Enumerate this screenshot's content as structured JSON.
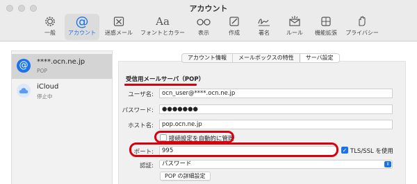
{
  "window": {
    "title": "アカウント"
  },
  "toolbar": {
    "tabs": [
      {
        "label": "一般",
        "icon": "gear-icon"
      },
      {
        "label": "アカウント",
        "icon": "at-sign-icon",
        "active": true
      },
      {
        "label": "迷惑メール",
        "icon": "junk-tray-icon"
      },
      {
        "label": "フォントとカラー",
        "icon": "font-aa-icon"
      },
      {
        "label": "表示",
        "icon": "glasses-icon"
      },
      {
        "label": "作成",
        "icon": "compose-icon"
      },
      {
        "label": "署名",
        "icon": "signature-icon"
      },
      {
        "label": "ルール",
        "icon": "rules-envelope-icon"
      },
      {
        "label": "機能拡張",
        "icon": "extensions-icon"
      },
      {
        "label": "プライバシー",
        "icon": "hand-privacy-icon"
      }
    ]
  },
  "sidebar": {
    "accounts": [
      {
        "name": "****.ocn.ne.jp",
        "subtitle": "POP",
        "icon": "at-sign-icon",
        "selected": true
      },
      {
        "name": "iCloud",
        "subtitle": "停止中",
        "icon": "cloud-icon",
        "selected": false
      }
    ]
  },
  "segments": {
    "items": [
      "アカウント情報",
      "メールボックスの特性",
      "サーバ設定"
    ],
    "active": "サーバ設定"
  },
  "incoming": {
    "title": "受信用メールサーバ（POP）",
    "username_label": "ユーザ名:",
    "username_value": "ocn_user@****.ocn.ne.jp",
    "password_label": "パスワード:",
    "password_value": "●●●●●●●",
    "host_label": "ホスト名:",
    "host_value": "pop.ocn.ne.jp",
    "auto_manage_label": "接続設定を自動的に管理",
    "auto_manage_checked": false,
    "port_label": "ポート:",
    "port_value": "995",
    "tls_label": "TLS/SSL を使用",
    "tls_checked": true,
    "auth_label": "認証:",
    "auth_value": "パスワード",
    "details_button": "POP の詳細設定"
  },
  "colors": {
    "accent": "#1a73e8",
    "highlight": "#d8000c"
  }
}
